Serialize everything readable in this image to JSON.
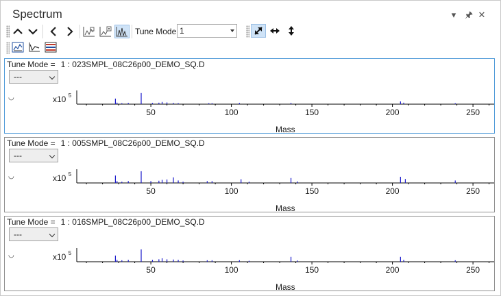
{
  "window": {
    "title": "Spectrum",
    "controls": {
      "dropdown": "▾",
      "pin": "🖈",
      "close": "✕"
    }
  },
  "toolbar": {
    "tune_mode_label": "Tune Mode:",
    "tune_mode_value": "1",
    "icons": [
      "chevron-up-icon",
      "chevron-down-icon",
      "chevron-left-icon",
      "chevron-right-icon",
      "overlay-spectrum-icon",
      "spectrum-settings-icon",
      "spectrum-peaks-icon",
      "autoscale-both-icon",
      "autoscale-x-icon",
      "autoscale-y-icon",
      "bar-chart-icon",
      "line-chart-icon",
      "list-color-icon"
    ]
  },
  "axis": {
    "ticks": [
      50,
      100,
      150,
      200,
      250
    ],
    "tick_labels": [
      "50",
      "100",
      "150",
      "200",
      "250"
    ],
    "label": "Mass",
    "scale_text": "x10",
    "scale_exp": "5",
    "x_range": [
      4,
      264
    ]
  },
  "panels": [
    {
      "tune_mode_label": "Tune Mode =",
      "sample": "1 : 023SMPL_08C26p00_DEMO_SQ.D",
      "combo_value": "---",
      "marker": "◡",
      "selected": true,
      "peaks": [
        [
          28,
          0.45
        ],
        [
          29,
          0.12
        ],
        [
          32,
          0.08
        ],
        [
          36,
          0.1
        ],
        [
          44,
          0.9
        ],
        [
          51,
          0.1
        ],
        [
          55,
          0.12
        ],
        [
          57,
          0.18
        ],
        [
          60,
          0.14
        ],
        [
          64,
          0.1
        ],
        [
          67,
          0.08
        ],
        [
          86,
          0.08
        ],
        [
          88,
          0.08
        ],
        [
          105,
          0.1
        ],
        [
          137,
          0.1
        ],
        [
          205,
          0.22
        ],
        [
          207,
          0.12
        ],
        [
          239,
          0.08
        ]
      ]
    },
    {
      "tune_mode_label": "Tune Mode =",
      "sample": "1 : 005SMPL_08C26p00_DEMO_SQ.D",
      "combo_value": "---",
      "marker": "◡",
      "selected": false,
      "peaks": [
        [
          28,
          0.6
        ],
        [
          29,
          0.15
        ],
        [
          32,
          0.1
        ],
        [
          36,
          0.15
        ],
        [
          44,
          0.95
        ],
        [
          50,
          0.15
        ],
        [
          55,
          0.18
        ],
        [
          57,
          0.25
        ],
        [
          60,
          0.28
        ],
        [
          64,
          0.45
        ],
        [
          67,
          0.2
        ],
        [
          70,
          0.1
        ],
        [
          85,
          0.15
        ],
        [
          88,
          0.15
        ],
        [
          106,
          0.3
        ],
        [
          111,
          0.1
        ],
        [
          137,
          0.4
        ],
        [
          141,
          0.12
        ],
        [
          205,
          0.5
        ],
        [
          208,
          0.32
        ],
        [
          239,
          0.2
        ]
      ]
    },
    {
      "tune_mode_label": "Tune Mode =",
      "sample": "1 : 016SMPL_08C26p00_DEMO_SQ.D",
      "combo_value": "---",
      "marker": "◡",
      "selected": false,
      "peaks": [
        [
          28,
          0.5
        ],
        [
          29,
          0.15
        ],
        [
          32,
          0.12
        ],
        [
          36,
          0.15
        ],
        [
          44,
          1.0
        ],
        [
          51,
          0.15
        ],
        [
          55,
          0.2
        ],
        [
          57,
          0.28
        ],
        [
          60,
          0.2
        ],
        [
          64,
          0.18
        ],
        [
          67,
          0.15
        ],
        [
          70,
          0.1
        ],
        [
          85,
          0.12
        ],
        [
          88,
          0.12
        ],
        [
          105,
          0.12
        ],
        [
          111,
          0.08
        ],
        [
          137,
          0.4
        ],
        [
          141,
          0.1
        ],
        [
          205,
          0.4
        ],
        [
          207,
          0.15
        ],
        [
          239,
          0.12
        ]
      ]
    }
  ],
  "colors": {
    "peak": "#1a1acc",
    "selected_border": "#4f9ad8",
    "active_button": "#cfe3f7"
  }
}
